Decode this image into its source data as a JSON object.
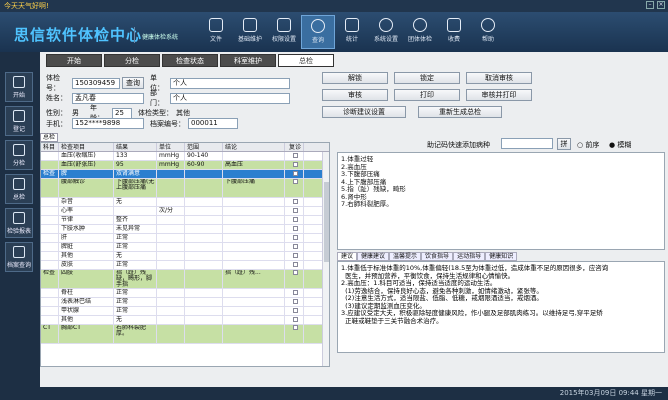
{
  "window_title": "今天天气好啊!",
  "brand": "思信软件体检中心",
  "brand_sub": "健康体检系统",
  "toolbar": [
    {
      "label": "文件",
      "icon": "file-icon"
    },
    {
      "label": "基础维护",
      "icon": "maintenance-icon"
    },
    {
      "label": "权限设置",
      "icon": "permission-icon"
    },
    {
      "label": "查询",
      "icon": "query-icon",
      "active": true
    },
    {
      "label": "统计",
      "icon": "stats-icon"
    },
    {
      "label": "系统设置",
      "icon": "settings-icon"
    },
    {
      "label": "团体体检",
      "icon": "group-icon"
    },
    {
      "label": "收费",
      "icon": "fee-icon"
    },
    {
      "label": "帮助",
      "icon": "help-icon"
    }
  ],
  "sidebar": [
    {
      "label": "开始",
      "icon": "start-icon"
    },
    {
      "label": "登记",
      "icon": "register-icon"
    },
    {
      "label": "分检",
      "icon": "triage-icon"
    },
    {
      "label": "总检",
      "icon": "summary-icon"
    },
    {
      "label": "检验报表",
      "icon": "report-icon"
    },
    {
      "label": "档案查询",
      "icon": "archive-icon"
    }
  ],
  "tabs": [
    "开始",
    "分检",
    "检查状态",
    "科室维护",
    "总检"
  ],
  "form": {
    "exam_no_label": "体检号：",
    "exam_no": "150309459",
    "query_btn": "查询",
    "unit_label": "单位：",
    "unit": "个人",
    "name_label": "姓名：",
    "name": "孟凡春",
    "dept_label": "部门：",
    "dept": "个人",
    "gender_label": "性别：",
    "gender": "男",
    "age_label": "年龄：",
    "age": "25",
    "type_label": "体检类型：",
    "type": "其他",
    "phone_label": "手机：",
    "phone": "152****9898",
    "file_label": "档案编号：",
    "file_no": "000011"
  },
  "right_buttons": [
    "解锁",
    "锁定",
    "取消审核",
    "审核",
    "打印",
    "审核并打印",
    "诊断建议设置",
    "重新生成总检"
  ],
  "panel_tab": "总检",
  "grid": {
    "headers": [
      "科目",
      "检查项目",
      "结果",
      "单位",
      "范围",
      "结论",
      "复诊"
    ],
    "rows": [
      {
        "c1": "",
        "c2": "血压(收缩压)",
        "c3": "133",
        "c4": "mmHg",
        "c5": "90-140",
        "c6": "",
        "cls": ""
      },
      {
        "c1": "",
        "c2": "血压(舒张压)",
        "c3": "95",
        "c4": "mmHg",
        "c5": "60-90",
        "c6": "高血压",
        "cls": "g"
      },
      {
        "c1": "检查",
        "c2": "脾",
        "c3": "双肾满意",
        "c4": "",
        "c5": "",
        "c6": "",
        "cls": "sel"
      },
      {
        "c1": "",
        "c2": "腹部触诊",
        "c3": "下腹部压痛(无上腹部压痛",
        "c4": "",
        "c5": "",
        "c6": "下腹部压痛",
        "cls": "g tall"
      },
      {
        "c1": "",
        "c2": "杂音",
        "c3": "无",
        "c4": "",
        "c5": "",
        "c6": "",
        "cls": ""
      },
      {
        "c1": "",
        "c2": "心率",
        "c3": "",
        "c4": "次/分",
        "c5": "",
        "c6": "",
        "cls": ""
      },
      {
        "c1": "",
        "c2": "节律",
        "c3": "整齐",
        "c4": "",
        "c5": "",
        "c6": "",
        "cls": ""
      },
      {
        "c1": "",
        "c2": "下肢水肿",
        "c3": "未见异常",
        "c4": "",
        "c5": "",
        "c6": "",
        "cls": ""
      },
      {
        "c1": "",
        "c2": "肝",
        "c3": "正常",
        "c4": "",
        "c5": "",
        "c6": "",
        "cls": ""
      },
      {
        "c1": "",
        "c2": "脾脏",
        "c3": "正常",
        "c4": "",
        "c5": "",
        "c6": "",
        "cls": ""
      },
      {
        "c1": "",
        "c2": "其他",
        "c3": "无",
        "c4": "",
        "c5": "",
        "c6": "",
        "cls": ""
      },
      {
        "c1": "",
        "c2": "皮肤",
        "c3": "正常",
        "c4": "",
        "c5": "",
        "c6": "",
        "cls": ""
      },
      {
        "c1": "检查",
        "c2": "四肢",
        "c3": "指（趾）残缺，畸形，脚手指",
        "c4": "",
        "c5": "",
        "c6": "指（趾）残...",
        "cls": "g tall"
      },
      {
        "c1": "",
        "c2": "脊柱",
        "c3": "正常",
        "c4": "",
        "c5": "",
        "c6": "",
        "cls": ""
      },
      {
        "c1": "",
        "c2": "浅表淋巴结",
        "c3": "正常",
        "c4": "",
        "c5": "",
        "c6": "",
        "cls": ""
      },
      {
        "c1": "",
        "c2": "甲状腺",
        "c3": "正常",
        "c4": "",
        "c5": "",
        "c6": "",
        "cls": ""
      },
      {
        "c1": "",
        "c2": "其他",
        "c3": "无",
        "c4": "",
        "c5": "",
        "c6": "",
        "cls": ""
      },
      {
        "c1": "CT",
        "c2": "胸部CT",
        "c3": "右肺科裂肥厚。",
        "c4": "",
        "c5": "",
        "c6": "",
        "cls": "g tall"
      }
    ]
  },
  "fast_label": "助记码快速添加病种",
  "fast_btn": "拼",
  "fast_options": [
    "前序",
    "模糊"
  ],
  "summary_text": "1.体重过轻\n2.高血压\n3.下腹部压痛\n4.上下腹部压痛\n5.指（趾）残缺，畸形\n6.肾中形\n7.右肺科裂肥厚。",
  "inner_tabs": [
    "建议",
    "健康建议",
    "温馨提示",
    "饮食指导",
    "运动指导",
    "健康知识"
  ],
  "advice_text": "1.体重低于标准体重的10%,体重偏轻(18.5至为体重过低，造成体重不足的原因很多，应咨询\n  医生，并预加营养，平衡饮食，保持生活规律和心情愉快。\n2.高血压：1.科目可适当，保持适当适度的运动生活。\n  (1)劳逸结合，保持良好心态，避免各种刺激，如情绪激动，紧张等。\n  (2)注意生活方式，适当限盐、低脂、低糖，戒烟限酒适当，戒烟酒。\n  (3)建议定期监测血压变化。\n3.应建议受定大夫，积极驱除轻度健康风险，作小腿及足部肌肉练习。以维持足弓,穿平足矫\n  正鞋或鞋垫于三关节融合术治疗。",
  "status": "2015年03月09日 09:44 星期一"
}
